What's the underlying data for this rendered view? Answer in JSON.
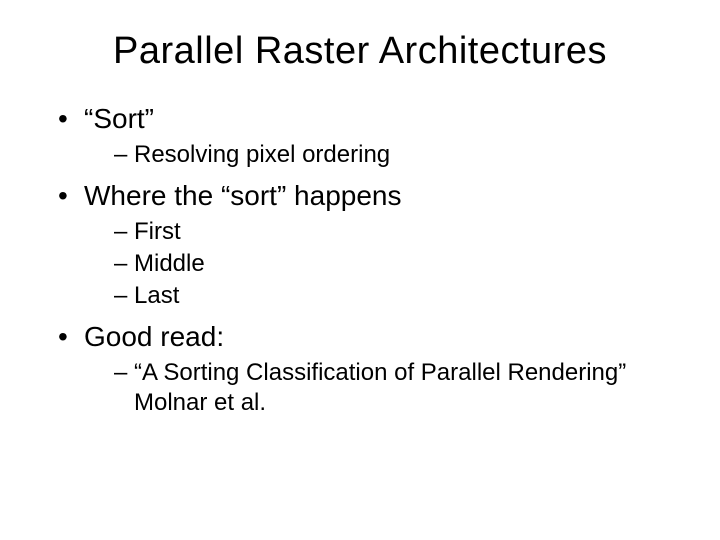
{
  "title": "Parallel Raster Architectures",
  "bullets": [
    {
      "text": "“Sort”",
      "sub": [
        "Resolving pixel ordering"
      ]
    },
    {
      "text": "Where the “sort” happens",
      "sub": [
        "First",
        "Middle",
        "Last"
      ]
    },
    {
      "text": "Good read:",
      "sub": [
        "“A Sorting Classification of Parallel Rendering” Molnar et al."
      ]
    }
  ]
}
